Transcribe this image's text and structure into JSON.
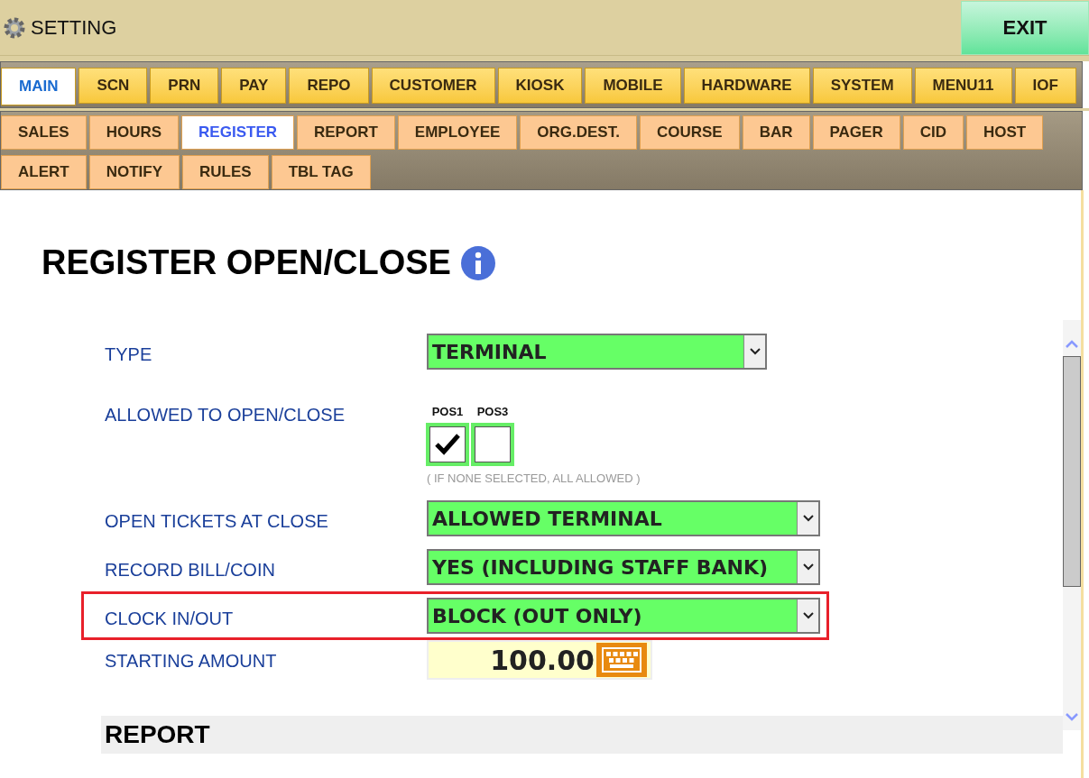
{
  "header": {
    "title": "SETTING",
    "exit_button": "EXIT"
  },
  "main_tabs": [
    {
      "label": "MAIN",
      "selected": true
    },
    {
      "label": "SCN",
      "selected": false
    },
    {
      "label": "PRN",
      "selected": false
    },
    {
      "label": "PAY",
      "selected": false
    },
    {
      "label": "REPO",
      "selected": false
    },
    {
      "label": "CUSTOMER",
      "selected": false
    },
    {
      "label": "KIOSK",
      "selected": false
    },
    {
      "label": "MOBILE",
      "selected": false
    },
    {
      "label": "HARDWARE",
      "selected": false
    },
    {
      "label": "SYSTEM",
      "selected": false
    },
    {
      "label": "MENU11",
      "selected": false
    },
    {
      "label": "IOF",
      "selected": false
    }
  ],
  "sub_tabs": [
    [
      {
        "label": "SALES",
        "selected": false
      },
      {
        "label": "HOURS",
        "selected": false
      },
      {
        "label": "REGISTER",
        "selected": true
      },
      {
        "label": "REPORT",
        "selected": false
      },
      {
        "label": "EMPLOYEE",
        "selected": false
      },
      {
        "label": "ORG.DEST.",
        "selected": false
      },
      {
        "label": "COURSE",
        "selected": false
      },
      {
        "label": "BAR",
        "selected": false
      },
      {
        "label": "PAGER",
        "selected": false
      },
      {
        "label": "CID",
        "selected": false
      },
      {
        "label": "HOST",
        "selected": false
      }
    ],
    [
      {
        "label": "ALERT",
        "selected": false
      },
      {
        "label": "NOTIFY",
        "selected": false
      },
      {
        "label": "RULES",
        "selected": false
      },
      {
        "label": "TBL TAG",
        "selected": false
      }
    ]
  ],
  "page_title": "REGISTER OPEN/CLOSE",
  "fields": [
    {
      "kind": "select",
      "label": "TYPE",
      "value": "TERMINAL",
      "wide": false,
      "highlighted": false
    },
    {
      "kind": "checkboxes",
      "label": "ALLOWED TO OPEN/CLOSE",
      "options": [
        {
          "label": "POS1",
          "checked": true
        },
        {
          "label": "POS3",
          "checked": false
        }
      ],
      "note": "( IF NONE SELECTED, ALL ALLOWED )"
    },
    {
      "kind": "select",
      "label": "OPEN TICKETS AT CLOSE",
      "value": "ALLOWED TERMINAL",
      "wide": true,
      "highlighted": false
    },
    {
      "kind": "select",
      "label": "RECORD BILL/COIN",
      "value": "YES (INCLUDING STAFF BANK)",
      "wide": true,
      "highlighted": false
    },
    {
      "kind": "select",
      "label": "CLOCK IN/OUT",
      "value": "BLOCK (OUT ONLY)",
      "wide": true,
      "highlighted": true
    },
    {
      "kind": "amount",
      "label": "STARTING AMOUNT",
      "value": "100.00"
    }
  ],
  "section_heading": "REPORT"
}
